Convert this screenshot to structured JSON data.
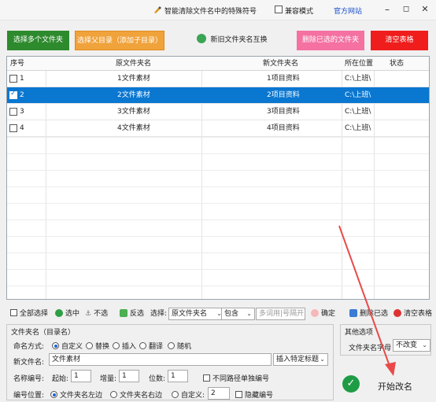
{
  "titlebar": {
    "title": "智能清除文件名中的特殊符号",
    "compat_label": "兼容模式",
    "official_link": "官方网站",
    "min_symbol": "–",
    "max_symbol": "◻",
    "close_symbol": "✕"
  },
  "toolbar": {
    "select_folders": "选择多个文件夹",
    "select_parent": "选择父目录（添加子目录）",
    "swap_names": "新旧文件夹名互换",
    "delete_selected": "删除已选的文件夹",
    "clear_table": "清空表格"
  },
  "table": {
    "headers": [
      "序号",
      "原文件夹名",
      "新文件夹名",
      "所在位置",
      "状态"
    ],
    "rows": [
      {
        "index": "1",
        "original": "1文件素材",
        "new": "1项目资料",
        "location": "C:\\上班\\",
        "status": "",
        "checked": false,
        "selected": false
      },
      {
        "index": "2",
        "original": "2文件素材",
        "new": "2项目资料",
        "location": "C:\\上班\\",
        "status": "",
        "checked": true,
        "selected": true
      },
      {
        "index": "3",
        "original": "3文件素材",
        "new": "3项目资料",
        "location": "C:\\上班\\",
        "status": "",
        "checked": false,
        "selected": false
      },
      {
        "index": "4",
        "original": "4文件素材",
        "new": "4项目资料",
        "location": "C:\\上班\\",
        "status": "",
        "checked": false,
        "selected": false
      }
    ]
  },
  "selection_bar": {
    "select_all": "全部选择",
    "select_checked": "选中",
    "unselect": "不选",
    "invert": "反选",
    "select_label": "选择:",
    "field_option": "原文件夹名",
    "match_option": "包含",
    "keywords_placeholder": "多词用|号隔开",
    "confirm": "确定",
    "delete_checked": "删除已选",
    "clear_table": "清空表格"
  },
  "naming": {
    "group_title": "文件夹名（目录名）",
    "mode_label": "命名方式:",
    "modes": [
      "自定义",
      "替换",
      "插入",
      "翻译",
      "随机"
    ],
    "mode_selected": "自定义",
    "new_name_label": "新文件名:",
    "new_name_value": "文件素材",
    "insert_title_option": "插入特定标题",
    "numbering_label": "名称编号:",
    "start_label": "起始:",
    "start_value": "1",
    "step_label": "增量:",
    "step_value": "1",
    "digits_label": "位数:",
    "digits_value": "1",
    "no_separate_path": "不同路径单独编号",
    "position_label": "编号位置:",
    "positions": [
      "文件夹名左边",
      "文件夹名右边",
      "自定义:"
    ],
    "position_selected": "文件夹名左边",
    "custom_position_value": "2",
    "hide_number": "隐藏编号"
  },
  "other": {
    "group_title": "其他选项",
    "case_label": "文件夹名字母",
    "case_option": "不改变"
  },
  "start": {
    "label": "开始改名"
  },
  "colors": {
    "green": "#2d8a2d",
    "orange": "#f0a23b",
    "pink": "#f471a1",
    "red": "#f01d1d",
    "selection": "#0a77d1",
    "annotation_arrow": "#e84a4a"
  }
}
